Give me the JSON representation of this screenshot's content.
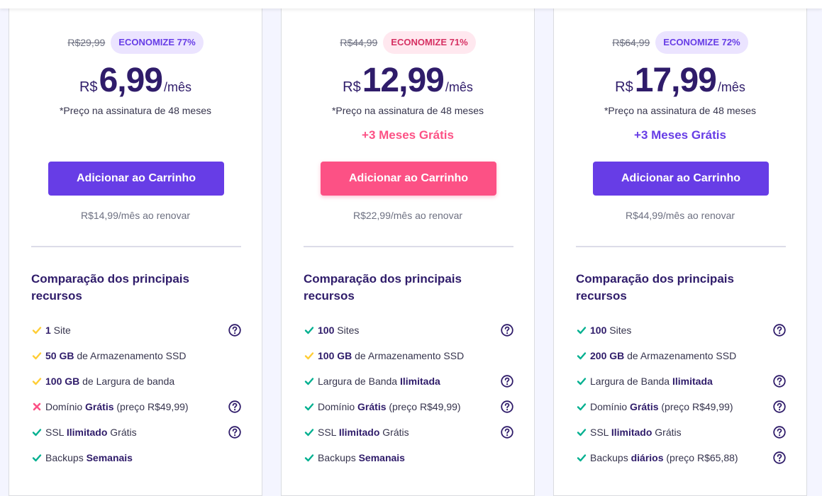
{
  "plans": [
    {
      "old_price": "R$29,99",
      "badge": "ECONOMIZE 77%",
      "badge_color": "#673de6",
      "currency": "R$",
      "amount": "6,99",
      "period": "/mês",
      "note": "*Preço na assinatura de 48 meses",
      "bonus": "",
      "button_label": "Adicionar ao Carrinho",
      "button_color": "#673de6",
      "renew": "R$14,99/mês ao renovar",
      "features_title": "Comparação dos principais recursos",
      "features": [
        {
          "status": "partial",
          "bold": "1",
          "text": " Site",
          "help": true
        },
        {
          "status": "partial",
          "bold": "50 GB",
          "text": " de Armazenamento SSD",
          "help": false
        },
        {
          "status": "partial",
          "bold": "100 GB",
          "text": " de Largura de banda",
          "help": false
        },
        {
          "status": "no",
          "pre": "Domínio ",
          "bold": "Grátis",
          "text": " (preço R$49,99)",
          "help": true
        },
        {
          "status": "yes",
          "pre": "SSL ",
          "bold": "Ilimitado",
          "text": " Grátis",
          "help": true
        },
        {
          "status": "yes",
          "pre": "Backups ",
          "bold": "Semanais",
          "text": "",
          "help": false
        }
      ]
    },
    {
      "old_price": "R$44,99",
      "badge": "ECONOMIZE 71%",
      "badge_color": "#d63163",
      "currency": "R$",
      "amount": "12,99",
      "period": "/mês",
      "note": "*Preço na assinatura de 48 meses",
      "bonus": "+3 Meses Grátis",
      "button_label": "Adicionar ao Carrinho",
      "button_color": "#fc5185",
      "renew": "R$22,99/mês ao renovar",
      "features_title": "Comparação dos principais recursos",
      "features": [
        {
          "status": "yes",
          "bold": "100",
          "text": " Sites",
          "help": true
        },
        {
          "status": "partial",
          "bold": "100 GB",
          "text": " de Armazenamento SSD",
          "help": false
        },
        {
          "status": "yes",
          "pre": "Largura de Banda ",
          "bold": "Ilimitada",
          "text": "",
          "help": true
        },
        {
          "status": "yes",
          "pre": "Domínio ",
          "bold": "Grátis",
          "text": " (preço R$49,99)",
          "help": true
        },
        {
          "status": "yes",
          "pre": "SSL ",
          "bold": "Ilimitado",
          "text": " Grátis",
          "help": true
        },
        {
          "status": "yes",
          "pre": "Backups ",
          "bold": "Semanais",
          "text": "",
          "help": false
        }
      ]
    },
    {
      "old_price": "R$64,99",
      "badge": "ECONOMIZE 72%",
      "badge_color": "#673de6",
      "currency": "R$",
      "amount": "17,99",
      "period": "/mês",
      "note": "*Preço na assinatura de 48 meses",
      "bonus": "+3 Meses Grátis",
      "button_label": "Adicionar ao Carrinho",
      "button_color": "#673de6",
      "renew": "R$44,99/mês ao renovar",
      "features_title": "Comparação dos principais recursos",
      "features": [
        {
          "status": "yes",
          "bold": "100",
          "text": " Sites",
          "help": true
        },
        {
          "status": "yes",
          "bold": "200 GB",
          "text": " de Armazenamento SSD",
          "help": false
        },
        {
          "status": "yes",
          "pre": "Largura de Banda ",
          "bold": "Ilimitada",
          "text": "",
          "help": true
        },
        {
          "status": "yes",
          "pre": "Domínio ",
          "bold": "Grátis",
          "text": " (preço R$49,99)",
          "help": true
        },
        {
          "status": "yes",
          "pre": "SSL ",
          "bold": "Ilimitado",
          "text": " Grátis",
          "help": true
        },
        {
          "status": "yes",
          "pre": "Backups ",
          "bold": "diários",
          "text": " (preço R$65,88)",
          "help": true
        }
      ]
    }
  ],
  "icons": {
    "yes": "check-icon",
    "partial": "check-icon",
    "no": "cross-icon",
    "help": "question-circle-icon"
  },
  "colors": {
    "yes": "#00b090",
    "partial": "#ffcd35",
    "no": "#fc5185",
    "help": "#2f1c6a"
  }
}
